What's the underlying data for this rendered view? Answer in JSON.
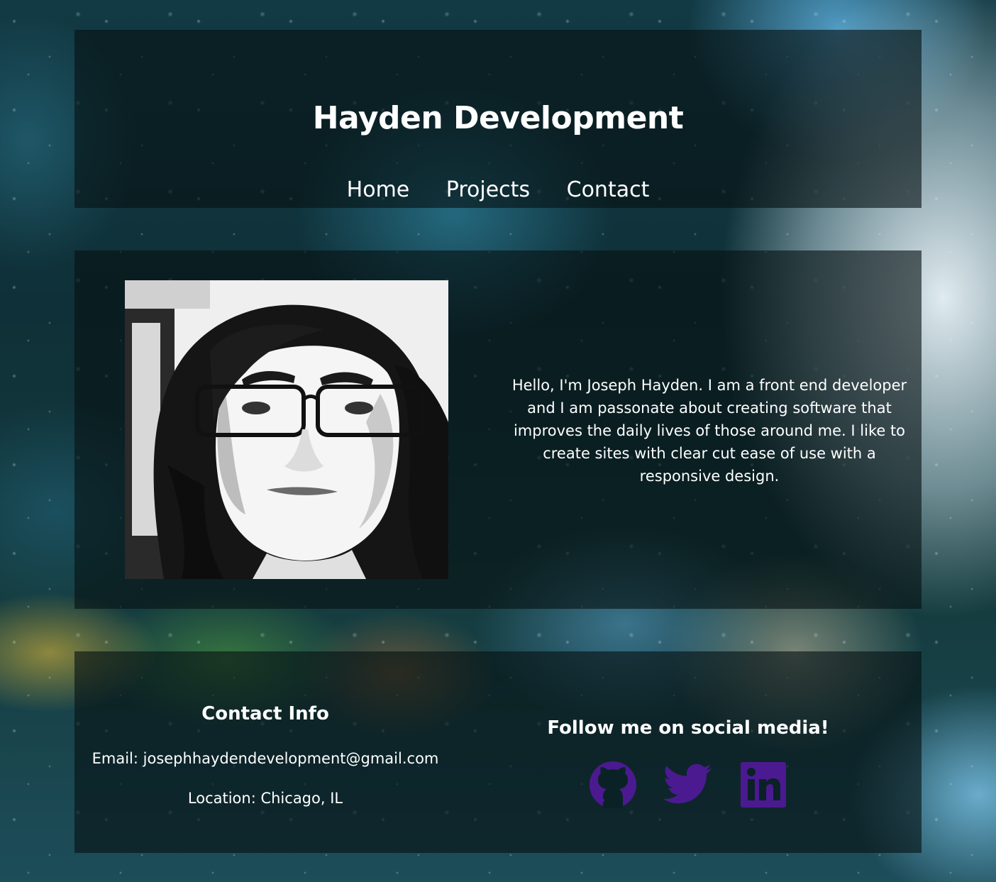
{
  "header": {
    "title": "Hayden Development",
    "nav": [
      "Home",
      "Projects",
      "Contact"
    ]
  },
  "about": {
    "photo_label": "Portrait of Joseph Hayden",
    "bio": "Hello, I'm Joseph Hayden. I am a front end developer and I am passonate about creating software that improves the daily lives of those around me. I like to create sites with clear cut ease of use with a responsive design."
  },
  "footer": {
    "contact_heading": "Contact Info",
    "email": "Email: josephhaydendevelopment@gmail.com",
    "location": "Location: Chicago, IL",
    "social_heading": "Follow me on social media!",
    "social_icons": [
      "github-icon",
      "twitter-icon",
      "linkedin-icon"
    ]
  },
  "colors": {
    "text": "#ffffff",
    "panel": "#061214",
    "social_icon": "#4b1a91"
  }
}
